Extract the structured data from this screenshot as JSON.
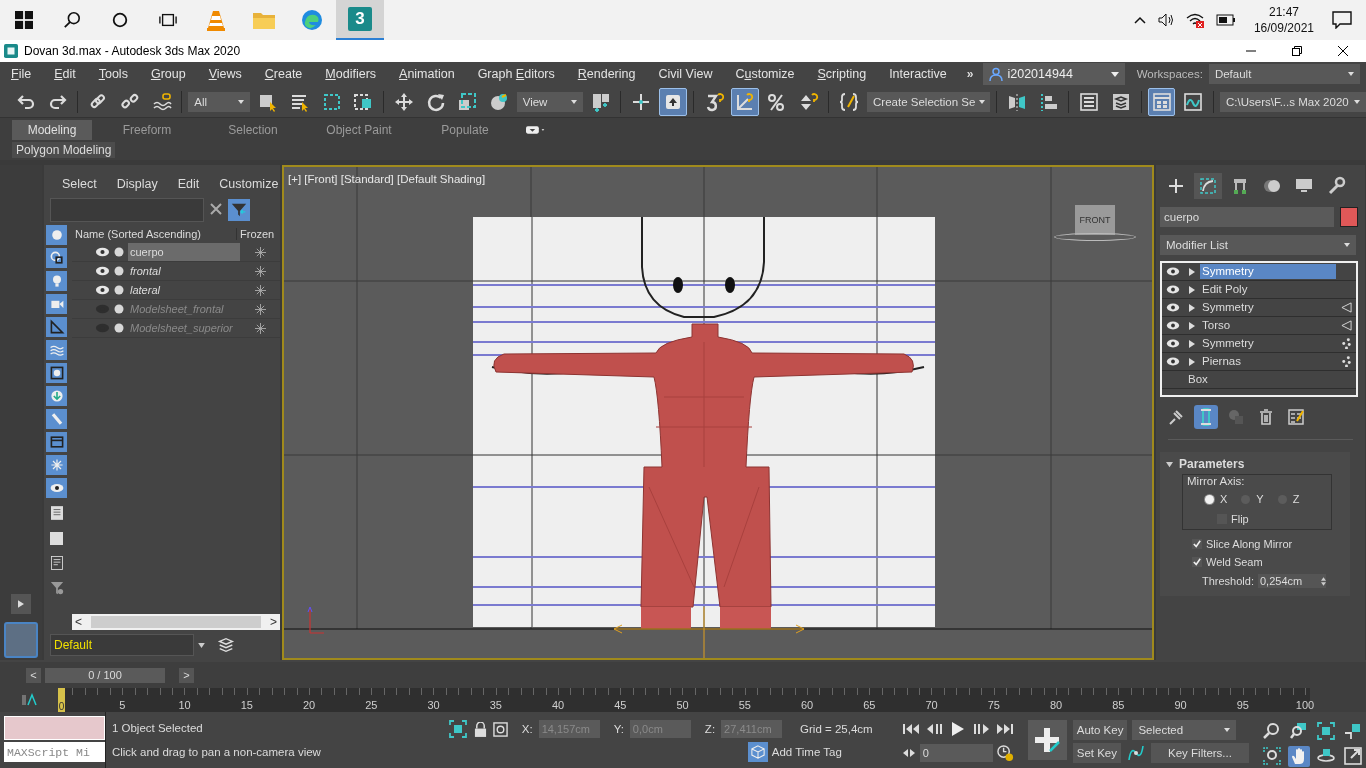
{
  "taskbar": {
    "apps": [
      {
        "kind": "vlc",
        "selected": false
      },
      {
        "kind": "folder",
        "selected": false
      },
      {
        "kind": "edge",
        "selected": false
      },
      {
        "kind": "max",
        "logo_text": "3",
        "selected": true
      }
    ],
    "time": "21:47",
    "date": "16/09/2021"
  },
  "window": {
    "title": "Dovan 3d.max - Autodesk 3ds Max 2020"
  },
  "menu": {
    "items": [
      "File",
      "Edit",
      "Tools",
      "Group",
      "Views",
      "Create",
      "Modifiers",
      "Animation",
      "Graph Editors",
      "Rendering",
      "Civil View",
      "Customize",
      "Scripting",
      "Interactive"
    ],
    "overflow": "»",
    "user": "i202014944",
    "workspaces_label": "Workspaces:",
    "workspace": "Default"
  },
  "toolbar": [
    {
      "kind": "undo",
      "active": false
    },
    {
      "kind": "redo",
      "active": false
    },
    {
      "kind": "separator"
    },
    {
      "kind": "link",
      "active": false
    },
    {
      "kind": "unlink",
      "active": false
    },
    {
      "kind": "bind",
      "active": false
    },
    {
      "kind": "separator"
    },
    {
      "kind": "filter",
      "value": "All"
    },
    {
      "kind": "select",
      "active": false
    },
    {
      "kind": "select-by-name",
      "active": false
    },
    {
      "kind": "rect-region",
      "active": false
    },
    {
      "kind": "window-crossing",
      "active": false
    },
    {
      "kind": "separator"
    },
    {
      "kind": "move",
      "active": false
    },
    {
      "kind": "rotate",
      "active": false
    },
    {
      "kind": "scale",
      "active": false
    },
    {
      "kind": "placement",
      "active": false
    },
    {
      "kind": "coordsys",
      "value": "View"
    },
    {
      "kind": "pivot",
      "active": false
    },
    {
      "kind": "separator"
    },
    {
      "kind": "axis",
      "active": false
    },
    {
      "kind": "select-place",
      "active": true
    },
    {
      "kind": "separator"
    },
    {
      "kind": "snap",
      "active": false
    },
    {
      "kind": "angle-snap",
      "active": true
    },
    {
      "kind": "percent-snap",
      "active": false
    },
    {
      "kind": "spinner-snap",
      "active": false
    },
    {
      "kind": "separator"
    },
    {
      "kind": "braces",
      "active": false
    },
    {
      "kind": "selset",
      "value": "Create Selection Se"
    },
    {
      "kind": "separator"
    },
    {
      "kind": "mirror",
      "active": false
    },
    {
      "kind": "align",
      "active": false
    },
    {
      "kind": "separator"
    },
    {
      "kind": "list",
      "active": false
    },
    {
      "kind": "layers",
      "active": false
    },
    {
      "kind": "separator"
    },
    {
      "kind": "ribbon",
      "active": true
    },
    {
      "kind": "curve",
      "active": false
    },
    {
      "kind": "separator"
    },
    {
      "kind": "project",
      "value": "C:\\Users\\F...s Max 2020"
    }
  ],
  "ribbon": {
    "tabs": [
      {
        "label": "Modeling",
        "selected": true
      },
      {
        "label": "Freeform",
        "selected": false
      },
      {
        "label": "Selection",
        "selected": false
      },
      {
        "label": "Object Paint",
        "selected": false
      },
      {
        "label": "Populate",
        "selected": false
      }
    ],
    "panel": "Polygon Modeling"
  },
  "scene_explorer": {
    "menus": [
      "Select",
      "Display",
      "Edit",
      "Customize"
    ],
    "columns": [
      "Name (Sorted Ascending)",
      "Frozen"
    ],
    "rows": [
      {
        "name": "cuerpo",
        "selected": true,
        "frozen": false,
        "hidden": false
      },
      {
        "name": "frontal",
        "selected": false,
        "frozen": true,
        "hidden": false
      },
      {
        "name": "lateral",
        "selected": false,
        "frozen": true,
        "hidden": false
      },
      {
        "name": "Modelsheet_frontal",
        "selected": false,
        "frozen": true,
        "hidden": true
      },
      {
        "name": "Modelsheet_superior",
        "selected": false,
        "frozen": true,
        "hidden": true
      }
    ],
    "scroll_left": "<",
    "scroll_right": ">",
    "layer": "Default"
  },
  "viewport": {
    "label": "[+] [Front] [Standard] [Default Shading]",
    "viewcube": "FRONT",
    "active": true
  },
  "command_panel": {
    "tabs": [
      {
        "kind": "create",
        "selected": false
      },
      {
        "kind": "modify",
        "selected": true
      },
      {
        "kind": "hierarchy",
        "selected": false
      },
      {
        "kind": "motion",
        "selected": false
      },
      {
        "kind": "display",
        "selected": false
      },
      {
        "kind": "utilities",
        "selected": false
      }
    ],
    "object": {
      "name": "cuerpo",
      "color": "#e05858"
    },
    "modifier_list": "Modifier List",
    "stack": [
      {
        "name": "Symmetry",
        "kind": "plain",
        "on": true,
        "selected": true
      },
      {
        "name": "Edit Poly",
        "kind": "plain",
        "on": true,
        "selected": false
      },
      {
        "name": "Symmetry",
        "kind": "triangle",
        "on": true,
        "selected": false
      },
      {
        "name": "Torso",
        "kind": "triangle",
        "on": true,
        "selected": false
      },
      {
        "name": "Symmetry",
        "kind": "dots",
        "on": true,
        "selected": false
      },
      {
        "name": "Piernas",
        "kind": "dots",
        "on": true,
        "selected": false
      },
      {
        "name": "Box",
        "kind": "base",
        "selected": false
      }
    ],
    "stack_tools": [
      {
        "kind": "pin",
        "active": false
      },
      {
        "kind": "end-result",
        "active": true
      },
      {
        "kind": "make-unique",
        "active": false
      },
      {
        "kind": "remove",
        "active": false
      },
      {
        "kind": "configure",
        "active": false
      }
    ],
    "rollout": {
      "title": "Parameters",
      "expanded": true,
      "group": "Mirror Axis:",
      "axes": [
        {
          "label": "X",
          "selected": true
        },
        {
          "label": "Y",
          "selected": false
        },
        {
          "label": "Z",
          "selected": false
        }
      ],
      "flip": {
        "label": "Flip",
        "checked": false
      },
      "options": [
        {
          "label": "Slice Along Mirror",
          "checked": true
        },
        {
          "label": "Weld Seam",
          "checked": true
        }
      ],
      "threshold": {
        "label": "Threshold:",
        "value": "0,254cm"
      }
    }
  },
  "timeline": {
    "prev": "<",
    "next": ">",
    "range": "0 / 100",
    "level": 0,
    "current": "0",
    "ticks": [
      "5",
      "10",
      "15",
      "20",
      "25",
      "30",
      "35",
      "40",
      "45",
      "50",
      "55",
      "60",
      "65",
      "70",
      "75",
      "80",
      "85",
      "90",
      "95",
      "100"
    ]
  },
  "status": {
    "listener": "MAXScript Mi",
    "selection": "1 Object Selected",
    "prompt": "Click and drag to pan a non-camera view",
    "coords": [
      {
        "axis": "X:",
        "value": "14,157cm",
        "disabled": true
      },
      {
        "axis": "Y:",
        "value": "0,0cm",
        "disabled": true
      },
      {
        "axis": "Z:",
        "value": "27,411cm",
        "disabled": true
      }
    ],
    "grid": "Grid = 25,4cm",
    "time_tag": "Add Time Tag",
    "frame": "0",
    "auto_key": "Auto Key",
    "set_key": "Set Key",
    "key_mode": "Selected",
    "key_filters": "Key Filters...",
    "nav": [
      {
        "kind": "zoom",
        "active": false
      },
      {
        "kind": "zoom-all",
        "active": false
      },
      {
        "kind": "zoom-extents",
        "active": false
      },
      {
        "kind": "zoom-extents-all",
        "active": false
      },
      {
        "kind": "zoom-region",
        "active": false
      },
      {
        "kind": "pan",
        "active": true
      },
      {
        "kind": "orbit",
        "active": false
      },
      {
        "kind": "maximize",
        "active": false
      }
    ]
  }
}
